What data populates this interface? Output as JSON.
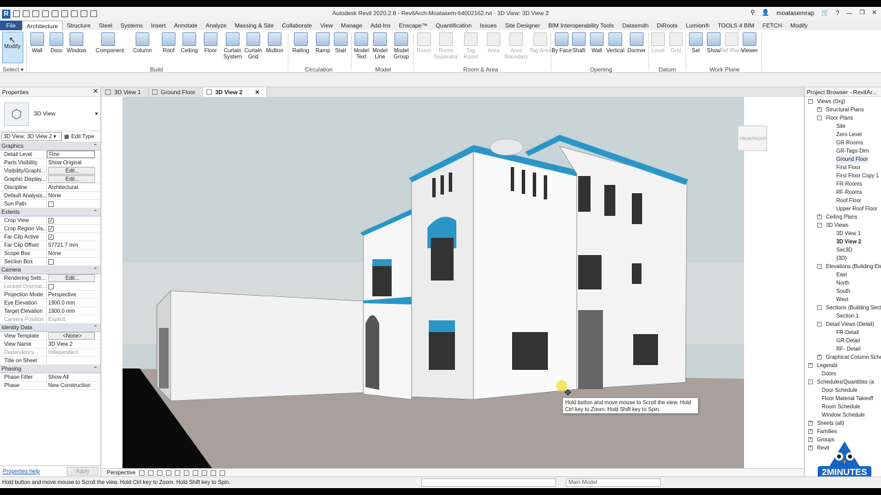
{
  "app_title": "Autodesk Revit 2020.2.8 - RevitArch-Moatasem-64002162.rvt - 3D View: 3D View 2",
  "user": "moatasemrap",
  "menu_tabs": [
    "File",
    "Architecture",
    "Structure",
    "Steel",
    "Systems",
    "Insert",
    "Annotate",
    "Analyze",
    "Massing & Site",
    "Collaborate",
    "View",
    "Manage",
    "Add-Ins",
    "Enscape™",
    "Quantification",
    "Issues",
    "Site Designer",
    "BIM Interoperability Tools",
    "Datasmith",
    "DiRoots",
    "Lumion®",
    "TOOLS 4 BIM",
    "FETCH",
    "Modify"
  ],
  "ribbon": {
    "modify": "Modify",
    "select": "Select",
    "build": [
      "Wall",
      "Door",
      "Window",
      "Component",
      "Column",
      "Roof",
      "Ceiling",
      "Floor",
      "Curtain System",
      "Curtain Grid",
      "Mullion"
    ],
    "circulation": [
      "Railing",
      "Ramp",
      "Stair"
    ],
    "model": [
      "Model Text",
      "Model Line",
      "Model Group"
    ],
    "room_area": [
      "Room",
      "Room Separator",
      "Tag Room",
      "Area",
      "Area Boundary",
      "Tag Area"
    ],
    "opening": [
      "By Face",
      "Shaft",
      "Wall",
      "Vertical",
      "Dormer"
    ],
    "datum": [
      "Level",
      "Grid"
    ],
    "work_plane": [
      "Set",
      "Show",
      "Ref Plane",
      "Viewer"
    ],
    "groups": [
      "Build",
      "Circulation",
      "Model",
      "Room & Area",
      "Opening",
      "Datum",
      "Work Plane"
    ]
  },
  "properties": {
    "header": "Properties",
    "type_name": "3D View",
    "selector": "3D View: 3D View 2",
    "edit_type": "Edit Type",
    "groups": [
      {
        "name": "Graphics",
        "rows": [
          {
            "k": "Detail Level",
            "v": "Fine",
            "style": "inp"
          },
          {
            "k": "Parts Visibility",
            "v": "Show Original"
          },
          {
            "k": "Visibility/Graphi...",
            "v": "Edit...",
            "style": "btn"
          },
          {
            "k": "Graphic Display...",
            "v": "Edit...",
            "style": "btn"
          },
          {
            "k": "Discipline",
            "v": "Architectural"
          },
          {
            "k": "Default Analysis...",
            "v": "None"
          },
          {
            "k": "Sun Path",
            "v": "",
            "style": "cb",
            "checked": false
          }
        ]
      },
      {
        "name": "Extents",
        "rows": [
          {
            "k": "Crop View",
            "v": "",
            "style": "cb",
            "checked": true
          },
          {
            "k": "Crop Region Vis...",
            "v": "",
            "style": "cb",
            "checked": true
          },
          {
            "k": "Far Clip Active",
            "v": "",
            "style": "cb",
            "checked": true
          },
          {
            "k": "Far Clip Offset",
            "v": "57721.7 mm"
          },
          {
            "k": "Scope Box",
            "v": "None"
          },
          {
            "k": "Section Box",
            "v": "",
            "style": "cb",
            "checked": false
          }
        ]
      },
      {
        "name": "Camera",
        "rows": [
          {
            "k": "Rendering Setti...",
            "v": "Edit...",
            "style": "btn"
          },
          {
            "k": "Locked Orientat...",
            "v": "",
            "style": "cb",
            "grey": true,
            "checked": false
          },
          {
            "k": "Projection Mode",
            "v": "Perspective"
          },
          {
            "k": "Eye Elevation",
            "v": "1900.0 mm"
          },
          {
            "k": "Target Elevation",
            "v": "1900.0 mm"
          },
          {
            "k": "Camera Position",
            "v": "Explicit",
            "grey": true
          }
        ]
      },
      {
        "name": "Identity Data",
        "rows": [
          {
            "k": "View Template",
            "v": "<None>",
            "style": "btn"
          },
          {
            "k": "View Name",
            "v": "3D View 2"
          },
          {
            "k": "Dependency",
            "v": "Independent",
            "grey": true
          },
          {
            "k": "Title on Sheet",
            "v": ""
          }
        ]
      },
      {
        "name": "Phasing",
        "rows": [
          {
            "k": "Phase Filter",
            "v": "Show All"
          },
          {
            "k": "Phase",
            "v": "New Construction"
          }
        ]
      }
    ],
    "help": "Properties help",
    "apply": "Apply"
  },
  "view_tabs": [
    {
      "label": "3D View 1",
      "active": false
    },
    {
      "label": "Ground Floor",
      "active": false
    },
    {
      "label": "3D View 2",
      "active": true
    }
  ],
  "viewcube": {
    "front": "FRONT",
    "right": "RIGHT"
  },
  "view_control": "Perspective",
  "tooltip": "Hold button and move mouse to Scroll the view. Hold Ctrl key to Zoom. Hold Shift key to Spin.",
  "status_text": "Hold button and move mouse to Scroll the view. Hold Ctrl key to Zoom. Hold Shift key to Spin.",
  "main_model": "Main Model",
  "browser": {
    "header": "Project Browser - RevitAr...",
    "nodes": [
      {
        "t": "Views (Org)",
        "d": 0,
        "ex": "-"
      },
      {
        "t": "Structural Plans",
        "d": 1,
        "ex": "+"
      },
      {
        "t": "Floor Plans",
        "d": 1,
        "ex": "-"
      },
      {
        "t": "Site",
        "d": 2
      },
      {
        "t": "Zero Level",
        "d": 2
      },
      {
        "t": "GR-Rooms",
        "d": 2
      },
      {
        "t": "GR-Tags-Dim",
        "d": 2
      },
      {
        "t": "Ground Floor",
        "d": 2,
        "hl": true
      },
      {
        "t": "First Floor",
        "d": 2
      },
      {
        "t": "First Floor Copy 1",
        "d": 2
      },
      {
        "t": "FR-Rooms",
        "d": 2
      },
      {
        "t": "RF-Rooms",
        "d": 2
      },
      {
        "t": "Roof Floor",
        "d": 2
      },
      {
        "t": "Upper Roof Floor",
        "d": 2
      },
      {
        "t": "Ceiling Plans",
        "d": 1,
        "ex": "+"
      },
      {
        "t": "3D Views",
        "d": 1,
        "ex": "-"
      },
      {
        "t": "3D View 1",
        "d": 2
      },
      {
        "t": "3D View 2",
        "d": 2,
        "sel": true
      },
      {
        "t": "Sec3D",
        "d": 2
      },
      {
        "t": "{3D}",
        "d": 2
      },
      {
        "t": "Elevations (Building Ele",
        "d": 1,
        "ex": "-"
      },
      {
        "t": "East",
        "d": 2
      },
      {
        "t": "North",
        "d": 2
      },
      {
        "t": "South",
        "d": 2
      },
      {
        "t": "West",
        "d": 2
      },
      {
        "t": "Sections (Building Sect",
        "d": 1,
        "ex": "-"
      },
      {
        "t": "Section 1",
        "d": 2
      },
      {
        "t": "Detail Views (Detail)",
        "d": 1,
        "ex": "-"
      },
      {
        "t": "FR-Detail",
        "d": 2
      },
      {
        "t": "GR-Detail",
        "d": 2
      },
      {
        "t": "RF- Detail",
        "d": 2
      },
      {
        "t": "Graphical Column Sche",
        "d": 1,
        "ex": "+"
      },
      {
        "t": "Legends",
        "d": 0,
        "ex": "+"
      },
      {
        "t": "Doors",
        "d": 1
      },
      {
        "t": "Schedules/Quantities (a",
        "d": 0,
        "ex": "-"
      },
      {
        "t": "Door Schedule",
        "d": 1
      },
      {
        "t": "Floor Material Takeoff",
        "d": 1
      },
      {
        "t": "Room Schedule",
        "d": 1
      },
      {
        "t": "Window Schedule",
        "d": 1
      },
      {
        "t": "Sheets (all)",
        "d": 0,
        "ex": "+"
      },
      {
        "t": "Families",
        "d": 0,
        "ex": "+"
      },
      {
        "t": "Groups",
        "d": 0,
        "ex": "+"
      },
      {
        "t": "Revit",
        "d": 0,
        "ex": "+"
      }
    ]
  },
  "badge": "2MINUTES",
  "colors": {
    "accent": "#2b5797",
    "trim": "#2a96c8",
    "ground": "#a9a09c",
    "sky": "#c8d4d6"
  }
}
